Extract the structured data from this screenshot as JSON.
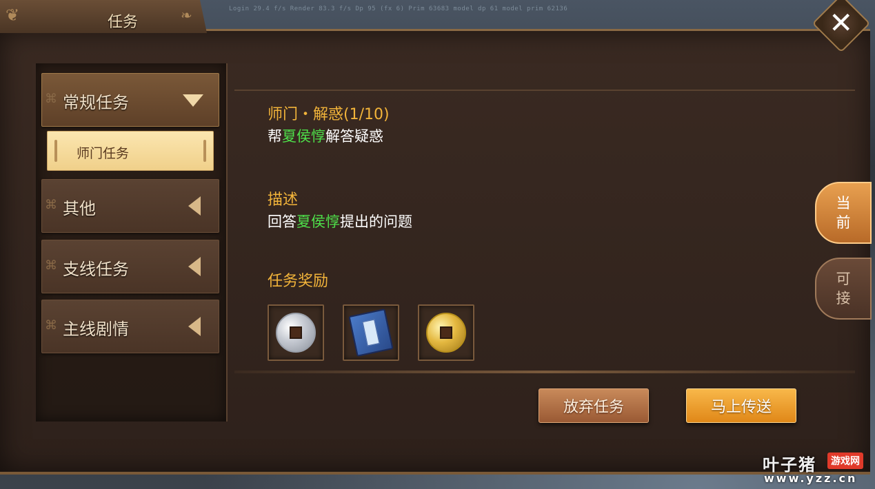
{
  "window": {
    "title": "任务",
    "debug_stats": "Login 29.4 f/s  Render 83.3 f/s  Dp 95 (fx 6)  Prim 63683 model dp 61 model prim 62136"
  },
  "sidebar": {
    "categories": [
      {
        "label": "常规任务",
        "expanded": true
      },
      {
        "label": "其他",
        "expanded": false
      },
      {
        "label": "支线任务",
        "expanded": false
      },
      {
        "label": "主线剧情",
        "expanded": false
      }
    ],
    "selected_sub_item": "师门任务"
  },
  "quest": {
    "title": "师门・解惑(1/10)",
    "objective_prefix": "帮",
    "objective_npc": "夏侯惇",
    "objective_suffix": "解答疑惑",
    "description_label": "描述",
    "description_prefix": "回答",
    "description_npc": "夏侯惇",
    "description_suffix": "提出的问题",
    "rewards_label": "任务奖励",
    "rewards": [
      {
        "icon": "silver-coin-icon"
      },
      {
        "icon": "blue-book-icon"
      },
      {
        "icon": "gold-coin-icon"
      }
    ]
  },
  "actions": {
    "abandon_label": "放弃任务",
    "teleport_label": "马上传送"
  },
  "side_tabs": {
    "current_line1": "当",
    "current_line2": "前",
    "available_line1": "可",
    "available_line2": "接"
  },
  "watermark": {
    "main": "叶子猪",
    "badge": "游戏网",
    "url": "www.yzz.cn"
  },
  "colors": {
    "quest_title": "#f2b43a",
    "npc_highlight": "#4ee04a",
    "teleport_button": "#e08818"
  }
}
